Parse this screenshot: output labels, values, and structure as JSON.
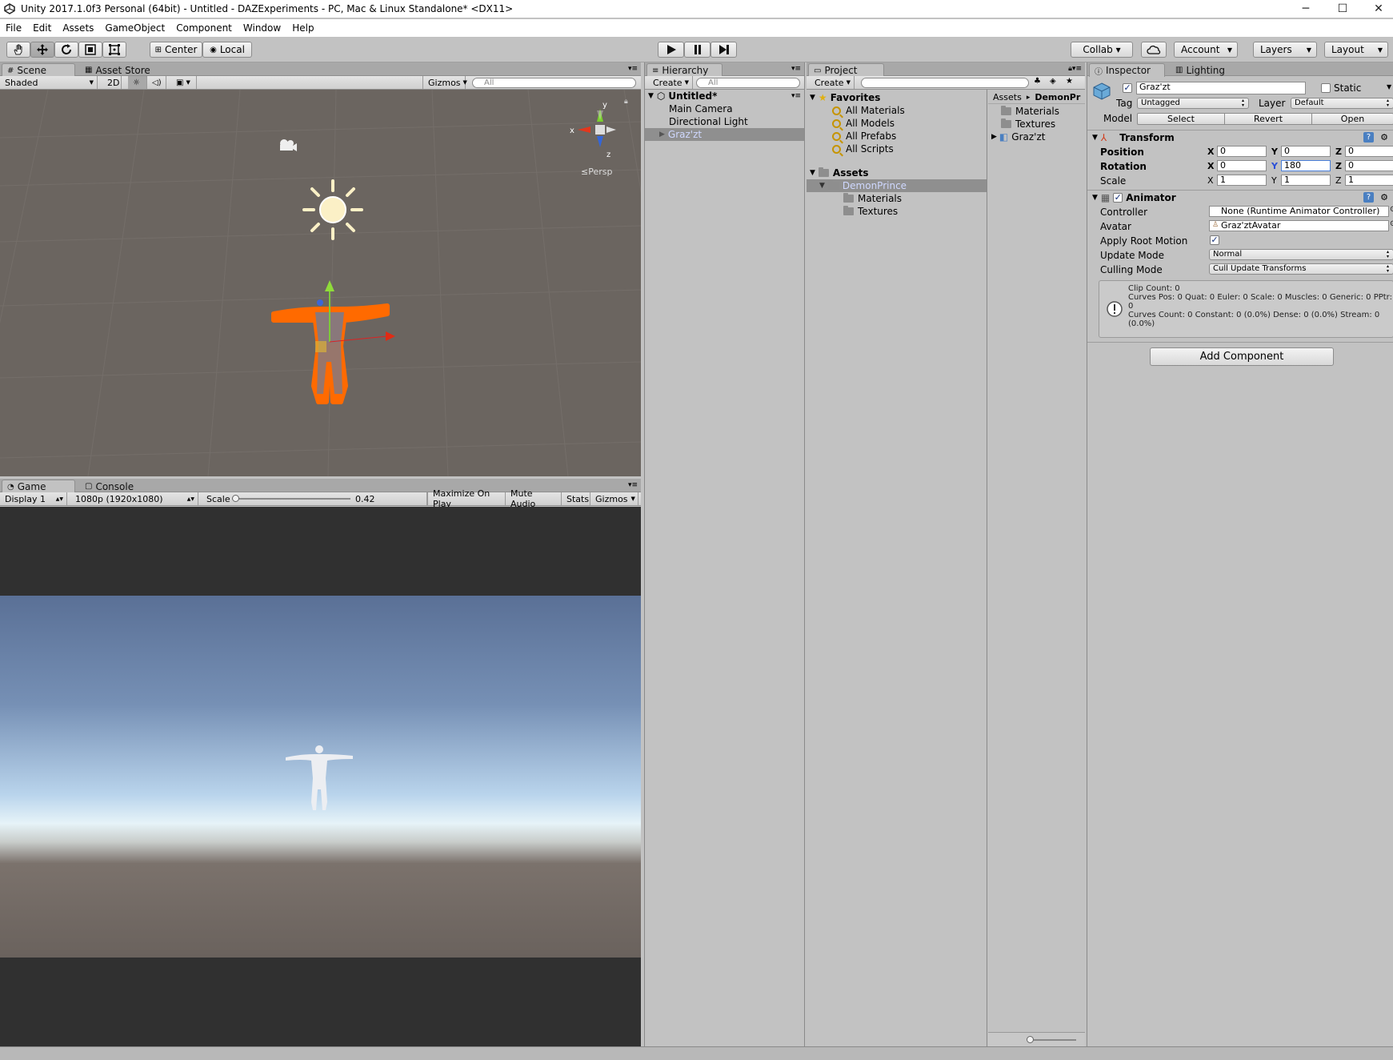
{
  "window": {
    "title": "Unity 2017.1.0f3 Personal (64bit) - Untitled - DAZExperiments - PC, Mac & Linux Standalone* <DX11>",
    "minimize": "─",
    "maximize": "☐",
    "close": "✕"
  },
  "menu": [
    "File",
    "Edit",
    "Assets",
    "GameObject",
    "Component",
    "Window",
    "Help"
  ],
  "toolbar": {
    "center_label": "Center",
    "local_label": "Local",
    "collab_label": "Collab ▾",
    "account_label": "Account",
    "layers_label": "Layers",
    "layout_label": "Layout"
  },
  "scene": {
    "tab_label": "Scene",
    "asset_store_label": "Asset Store",
    "shading_mode": "Shaded",
    "mode_2d": "2D",
    "gizmos_label": "Gizmos",
    "search_placeholder": "All",
    "persp_label": "Persp",
    "axis_x": "x",
    "axis_y": "y",
    "axis_z": "z"
  },
  "game": {
    "tab_label": "Game",
    "console_label": "Console",
    "display": "Display 1",
    "resolution": "1080p (1920x1080)",
    "scale_label": "Scale",
    "scale_value": "0.42",
    "scale_fraction": 0.03,
    "maximize_on_play": "Maximize On Play",
    "mute_audio": "Mute Audio",
    "stats": "Stats",
    "gizmos": "Gizmos"
  },
  "hierarchy": {
    "tab_label": "Hierarchy",
    "create_label": "Create",
    "search_placeholder": "All",
    "scene_name": "Untitled*",
    "items": [
      "Main Camera",
      "Directional Light",
      "Graz'zt"
    ]
  },
  "project": {
    "tab_label": "Project",
    "create_label": "Create",
    "favorites_label": "Favorites",
    "favorites": [
      "All Materials",
      "All Models",
      "All Prefabs",
      "All Scripts"
    ],
    "assets_label": "Assets",
    "tree": [
      "DemonPrince",
      "Materials",
      "Textures"
    ],
    "breadcrumb_root": "Assets",
    "breadcrumb_sep": "▸",
    "breadcrumb_current": "DemonPr",
    "contents": [
      "Materials",
      "Textures",
      "Graz'zt"
    ]
  },
  "inspector": {
    "tab_label": "Inspector",
    "lighting_label": "Lighting",
    "object_name": "Graz'zt",
    "static_label": "Static",
    "tag_label": "Tag",
    "tag_value": "Untagged",
    "layer_label": "Layer",
    "layer_value": "Default",
    "model_label": "Model",
    "select_label": "Select",
    "revert_label": "Revert",
    "open_label": "Open",
    "transform": {
      "title": "Transform",
      "position_label": "Position",
      "rotation_label": "Rotation",
      "scale_label": "Scale",
      "position": {
        "x": "0",
        "y": "0",
        "z": "0"
      },
      "rotation": {
        "x": "0",
        "y": "180",
        "z": "0"
      },
      "scale": {
        "x": "1",
        "y": "1",
        "z": "1"
      }
    },
    "animator": {
      "title": "Animator",
      "controller_label": "Controller",
      "controller_value": "None (Runtime Animator Controller)",
      "avatar_label": "Avatar",
      "avatar_value": "Graz'ztAvatar",
      "apply_root_motion_label": "Apply Root Motion",
      "update_mode_label": "Update Mode",
      "update_mode_value": "Normal",
      "culling_mode_label": "Culling Mode",
      "culling_mode_value": "Cull Update Transforms",
      "info": "Clip Count: 0\nCurves Pos: 0 Quat: 0 Euler: 0 Scale: 0 Muscles: 0 Generic: 0 PPtr: 0\nCurves Count: 0 Constant: 0 (0.0%) Dense: 0 (0.0%) Stream: 0 (0.0%)"
    },
    "add_component_label": "Add Component"
  },
  "axis_labels": {
    "x": "X",
    "y": "Y",
    "z": "Z"
  },
  "colors": {
    "scene_bg": "#6b6560",
    "selection_orange": "#ff6a00",
    "sky_top": "#5a7096",
    "sky_horizon": "#dceefa",
    "ground": "#6a625d"
  }
}
